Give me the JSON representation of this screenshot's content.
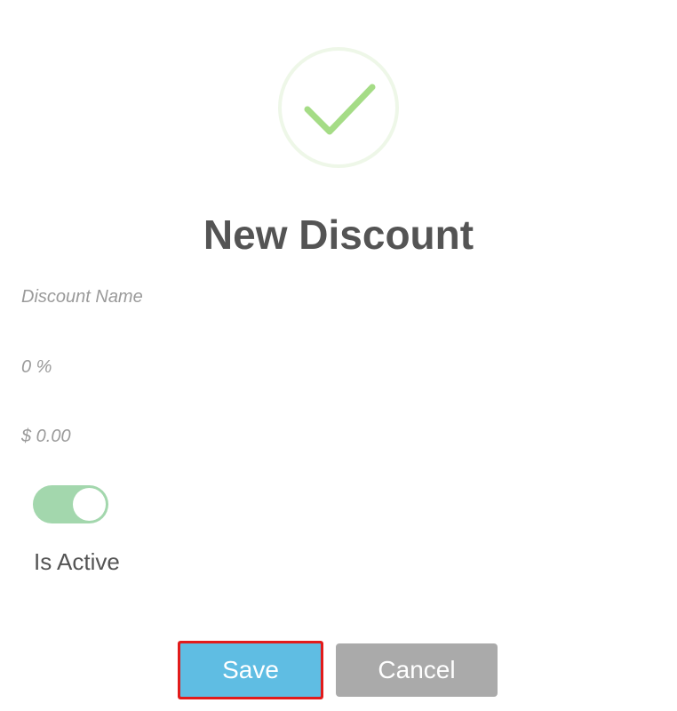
{
  "dialog": {
    "icon": "success-checkmark-icon",
    "title": "New Discount"
  },
  "form": {
    "discount_name": {
      "value": "",
      "placeholder": "Discount Name"
    },
    "percent": {
      "value": "",
      "placeholder": "0 %"
    },
    "amount": {
      "value": "",
      "placeholder": "$ 0.00"
    },
    "is_active": {
      "label": "Is Active",
      "checked": true
    }
  },
  "actions": {
    "save_label": "Save",
    "cancel_label": "Cancel"
  },
  "colors": {
    "success_ring": "#eef7e8",
    "success_check": "#a5dc86",
    "title_text": "#545454",
    "toggle_on": "#a3d7ad",
    "save_button": "#5fbde3",
    "save_focus_outline": "#e21b1b",
    "cancel_button": "#aaaaaa"
  }
}
